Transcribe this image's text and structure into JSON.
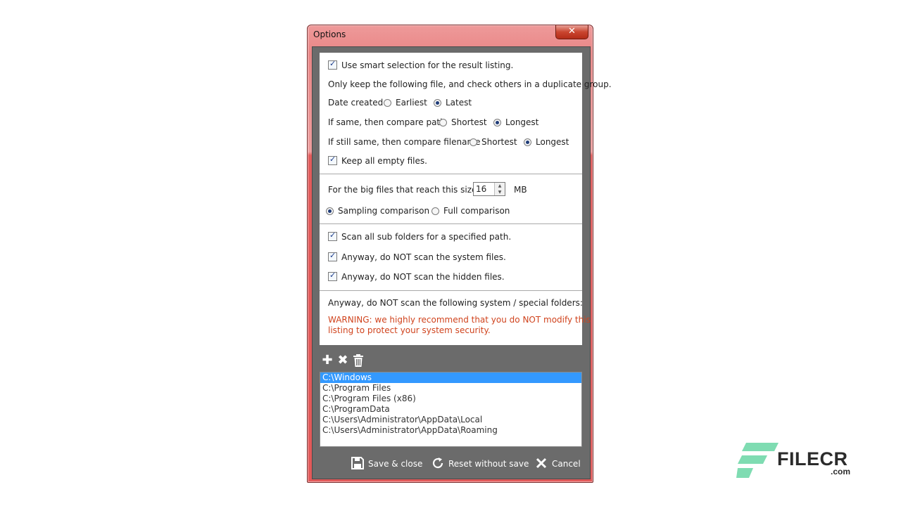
{
  "window": {
    "title": "Options",
    "close_label": "✕"
  },
  "smart": {
    "use_smart_label": "Use smart selection for the result listing.",
    "use_smart_checked": true,
    "keep_desc": "Only keep the following file, and check others in a duplicate group.",
    "date_label": "Date created",
    "date_opt1": "Earliest",
    "date_opt2": "Latest",
    "date_selected": "Latest",
    "path_label": "If same, then compare path",
    "path_opt1": "Shortest",
    "path_opt2": "Longest",
    "path_selected": "Longest",
    "filename_label": "If still same, then compare filename",
    "filename_opt1": "Shortest",
    "filename_opt2": "Longest",
    "filename_selected": "Longest",
    "keep_empty_label": "Keep all empty files.",
    "keep_empty_checked": true
  },
  "bigfiles": {
    "label": "For the big files that reach this size",
    "size_value": "16",
    "unit": "MB",
    "sampling_label": "Sampling comparison",
    "full_label": "Full comparison",
    "selected": "Sampling comparison"
  },
  "scan": {
    "subfolders_label": "Scan all sub folders for a specified path.",
    "system_label": "Anyway, do NOT scan the system files.",
    "hidden_label": "Anyway, do NOT scan the hidden files.",
    "subfolders_checked": true,
    "system_checked": true,
    "hidden_checked": true
  },
  "folders": {
    "heading": "Anyway, do NOT scan the following system / special folders:",
    "warning_line1": "WARNING: we highly recommend that you do NOT modify this",
    "warning_line2": "listing to protect your system security.",
    "items": [
      "C:\\Windows",
      "C:\\Program Files",
      "C:\\Program Files (x86)",
      "C:\\ProgramData",
      "C:\\Users\\Administrator\\AppData\\Local",
      "C:\\Users\\Administrator\\AppData\\Roaming"
    ],
    "selected_index": 0
  },
  "toolbar_icons": [
    "add-icon",
    "remove-icon",
    "trash-icon"
  ],
  "buttons": {
    "save": "Save & close",
    "reset": "Reset without save",
    "cancel": "Cancel"
  },
  "watermark": {
    "name": "FILECR",
    "domain": ".com"
  },
  "colors": {
    "frame": "#e25a5a",
    "client": "#6b6b6b",
    "warning": "#d0431d",
    "selection": "#3399ff"
  }
}
